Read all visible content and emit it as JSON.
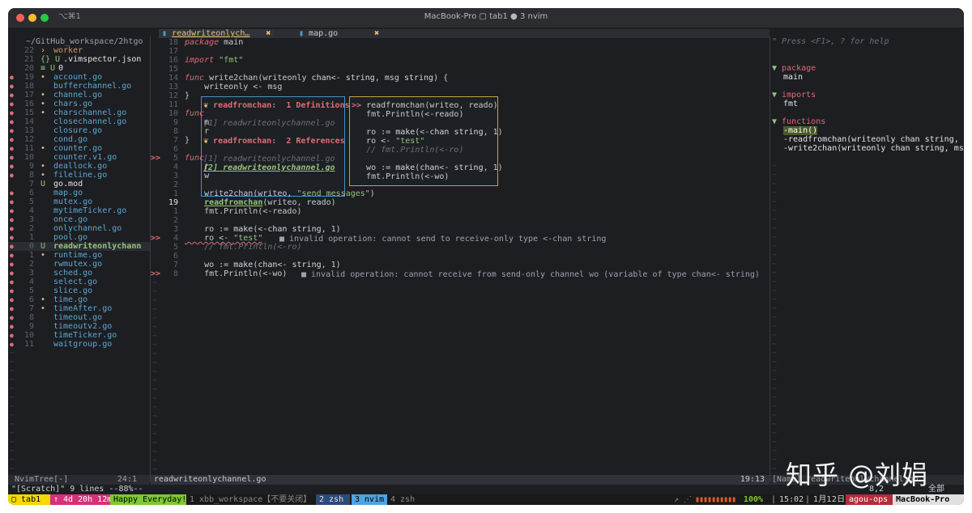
{
  "window": {
    "shortcut": "⌥⌘1",
    "title": "MacBook-Pro ▢ tab1 ● 3 nvim"
  },
  "tabs": [
    {
      "label": "readwriteonlych…",
      "close": "✖"
    },
    {
      "label": "map.go",
      "close": "✖"
    }
  ],
  "tree": {
    "root": "~/GitHub_workspace/2htgo",
    "items": [
      {
        "num": "22",
        "sign": "",
        "mark": "›",
        "name": "worker",
        "kind": "dir"
      },
      {
        "num": "21",
        "sign": "",
        "mark": "{} U",
        "name": ".vimspector.json",
        "kind": "json"
      },
      {
        "num": "20",
        "sign": "",
        "mark": "≡ U",
        "name": "0",
        "kind": "plain"
      },
      {
        "num": "19",
        "sign": "●",
        "mark": "•",
        "name": "account.go",
        "kind": "go"
      },
      {
        "num": "18",
        "sign": "●",
        "mark": "",
        "name": "bufferchannel.go",
        "kind": "go"
      },
      {
        "num": "17",
        "sign": "●",
        "mark": "•",
        "name": "channel.go",
        "kind": "go"
      },
      {
        "num": "16",
        "sign": "●",
        "mark": "•",
        "name": "chars.go",
        "kind": "go"
      },
      {
        "num": "15",
        "sign": "●",
        "mark": "•",
        "name": "charschannel.go",
        "kind": "go"
      },
      {
        "num": "14",
        "sign": "●",
        "mark": "",
        "name": "closechannel.go",
        "kind": "go"
      },
      {
        "num": "13",
        "sign": "●",
        "mark": "",
        "name": "closure.go",
        "kind": "go"
      },
      {
        "num": "12",
        "sign": "●",
        "mark": "",
        "name": "cond.go",
        "kind": "go"
      },
      {
        "num": "11",
        "sign": "●",
        "mark": "•",
        "name": "counter.go",
        "kind": "go"
      },
      {
        "num": "10",
        "sign": "●",
        "mark": "",
        "name": "counter.v1.go",
        "kind": "go"
      },
      {
        "num": "9",
        "sign": "●",
        "mark": "•",
        "name": "deallock.go",
        "kind": "go"
      },
      {
        "num": "8",
        "sign": "●",
        "mark": "•",
        "name": "fileline.go",
        "kind": "go"
      },
      {
        "num": "7",
        "sign": "",
        "mark": "U",
        "name": "go.mod",
        "kind": "plain"
      },
      {
        "num": "6",
        "sign": "●",
        "mark": "",
        "name": "map.go",
        "kind": "go"
      },
      {
        "num": "5",
        "sign": "●",
        "mark": "",
        "name": "mutex.go",
        "kind": "go"
      },
      {
        "num": "4",
        "sign": "●",
        "mark": "",
        "name": "mytimeTicker.go",
        "kind": "go"
      },
      {
        "num": "3",
        "sign": "●",
        "mark": "",
        "name": "once.go",
        "kind": "go"
      },
      {
        "num": "2",
        "sign": "●",
        "mark": "",
        "name": "onlychannel.go",
        "kind": "go"
      },
      {
        "num": "1",
        "sign": "●",
        "mark": "",
        "name": "pool.go",
        "kind": "go"
      },
      {
        "num": "0",
        "sign": "●",
        "mark": "U",
        "name": "readwriteonlychann",
        "kind": "current"
      },
      {
        "num": "1",
        "sign": "●",
        "mark": "•",
        "name": "runtime.go",
        "kind": "go"
      },
      {
        "num": "2",
        "sign": "●",
        "mark": "",
        "name": "rwmutex.go",
        "kind": "go"
      },
      {
        "num": "3",
        "sign": "●",
        "mark": "",
        "name": "sched.go",
        "kind": "go"
      },
      {
        "num": "4",
        "sign": "●",
        "mark": "",
        "name": "select.go",
        "kind": "go"
      },
      {
        "num": "5",
        "sign": "●",
        "mark": "",
        "name": "slice.go",
        "kind": "go"
      },
      {
        "num": "6",
        "sign": "●",
        "mark": "•",
        "name": "time.go",
        "kind": "go"
      },
      {
        "num": "7",
        "sign": "●",
        "mark": "•",
        "name": "timeAfter.go",
        "kind": "go"
      },
      {
        "num": "8",
        "sign": "●",
        "mark": "",
        "name": "timeout.go",
        "kind": "go"
      },
      {
        "num": "9",
        "sign": "●",
        "mark": "",
        "name": "timeoutv2.go",
        "kind": "go"
      },
      {
        "num": "10",
        "sign": "●",
        "mark": "",
        "name": "timeTicker.go",
        "kind": "go"
      },
      {
        "num": "11",
        "sign": "●",
        "mark": "",
        "name": "waitgroup.go",
        "kind": "go"
      }
    ]
  },
  "code": [
    {
      "sign": "",
      "num": "18",
      "text": "package main"
    },
    {
      "sign": "",
      "num": "17",
      "text": ""
    },
    {
      "sign": "",
      "num": "16",
      "text": "import \"fmt\""
    },
    {
      "sign": "",
      "num": "15",
      "text": ""
    },
    {
      "sign": "",
      "num": "14",
      "text": "func write2chan(writeonly chan<- string, msg string) {"
    },
    {
      "sign": "",
      "num": "13",
      "text": "    writeonly <- msg"
    },
    {
      "sign": "",
      "num": "12",
      "text": "}"
    },
    {
      "sign": "",
      "num": "11",
      "text": ""
    },
    {
      "sign": "",
      "num": "10",
      "text": "func"
    },
    {
      "sign": "",
      "num": "9",
      "text": "    m"
    },
    {
      "sign": "",
      "num": "8",
      "text": "    r"
    },
    {
      "sign": "",
      "num": "7",
      "text": "}"
    },
    {
      "sign": "",
      "num": "6",
      "text": ""
    },
    {
      "sign": ">>",
      "num": "5",
      "text": "func"
    },
    {
      "sign": "",
      "num": "4",
      "text": "    r"
    },
    {
      "sign": "",
      "num": "3",
      "text": "    w"
    },
    {
      "sign": "",
      "num": "2",
      "text": ""
    },
    {
      "sign": "",
      "num": "1",
      "text": "    write2chan(writeo, \"send messages\")"
    },
    {
      "sign": "",
      "num": "19",
      "text": "    readfromchan(writeo, reado)"
    },
    {
      "sign": "",
      "num": "1",
      "text": "    fmt.Println(<-reado)"
    },
    {
      "sign": "",
      "num": "2",
      "text": ""
    },
    {
      "sign": "",
      "num": "3",
      "text": "    ro := make(<-chan string, 1)"
    },
    {
      "sign": ">>",
      "num": "4",
      "text": "    ro <- \"test\""
    },
    {
      "sign": "",
      "num": "5",
      "text": "    // fmt.Println(<-ro)"
    },
    {
      "sign": "",
      "num": "6",
      "text": ""
    },
    {
      "sign": "",
      "num": "7",
      "text": "    wo := make(chan<- string, 1)"
    },
    {
      "sign": ">>",
      "num": "8",
      "text": "    fmt.Println(<-wo)"
    }
  ],
  "diagnostics": {
    "line22": "■ invalid operation: cannot send to receive-only type <-chan string",
    "line26": "■ invalid operation: cannot receive from send-only channel wo (variable of type chan<- string)"
  },
  "popup": {
    "def_header": "readfromchan:  1 Definitions",
    "def_item": "[1] readwriteonlychannel.go",
    "ref_header": "readfromchan:  2 References",
    "ref_item1": "[1] readwriteonlychannel.go",
    "ref_item2": "[2] readwriteonlychannel.go",
    "preview": [
      ">> readfromchan(writeo, reado)",
      "   fmt.Println(<-reado)",
      "",
      "   ro := make(<-chan string, 1)",
      "   ro <- \"test\"",
      "   // fmt.Println(<-ro)",
      "",
      "   wo := make(chan<- string, 1)",
      "   fmt.Println(<-wo)"
    ]
  },
  "tagbar": {
    "help": "\" Press <F1>, ? for help",
    "groups": [
      {
        "label": "package",
        "items": [
          "main"
        ]
      },
      {
        "label": "imports",
        "items": [
          "fmt"
        ]
      },
      {
        "label": "functions",
        "items": [
          "-main()",
          "-readfromchan(writeonly chan string,",
          "-write2chan(writeonly chan string, ms"
        ]
      }
    ]
  },
  "statusline": {
    "tree_name": "NvimTree[-]",
    "tree_pos": "24:1",
    "file_name": "readwriteonlychannel.go",
    "file_pos": "19:13",
    "tag_name": "[Name] readwriteonlychannel.go",
    "tag_pos": "8,2",
    "tag_all": "全部"
  },
  "cmdline": "\"[Scratch]\" 9 lines --88%--",
  "tmux": {
    "session": "▢ tab1",
    "uptime": "↑ 4d 20h 12m",
    "motto": "Happy Everyday!",
    "win1": "1 xbb_workspace【不要关闭】",
    "win2": "2 zsh",
    "win3": "3 nvim",
    "win4": "4 zsh",
    "battery": "100%",
    "time": "15:02",
    "date": "1月12日",
    "user": "agou-ops",
    "host": "MacBook-Pro"
  },
  "watermark": "知乎 @刘娟",
  "colors": {
    "accent_green": "#98c379",
    "accent_red": "#e06c75",
    "go_file": "#5fa8d3",
    "tmux_nvim": "#4fa3e0"
  }
}
